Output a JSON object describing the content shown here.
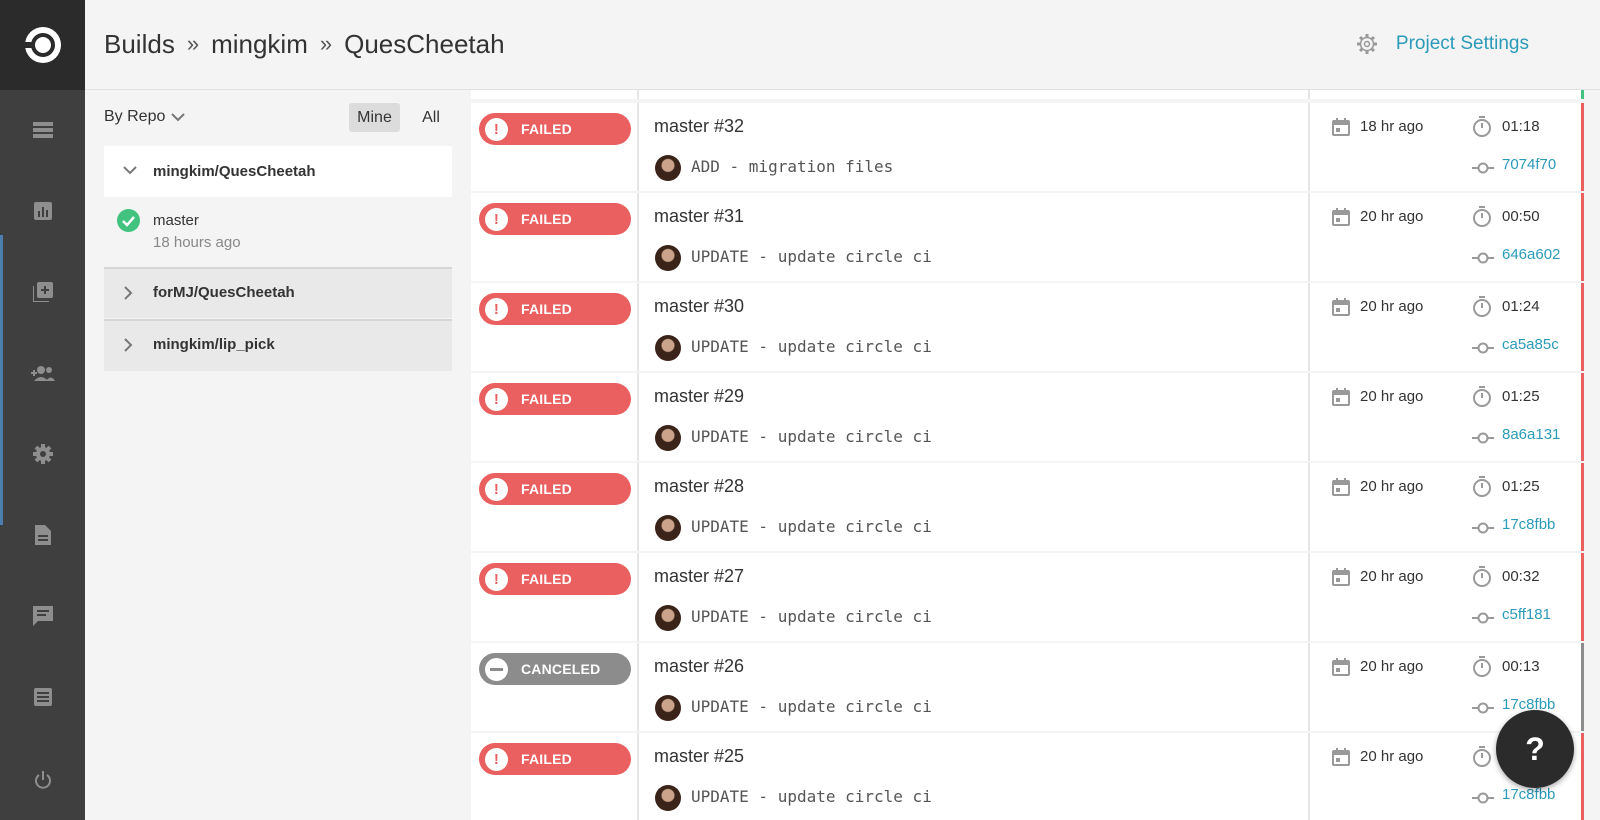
{
  "header": {
    "crumbs": [
      "Builds",
      "mingkim",
      "QuesCheetah"
    ],
    "separator": "»",
    "settings_label": "Project Settings"
  },
  "sidebar_rail": {
    "icons": [
      "circleci-logo-icon",
      "builds-icon",
      "insights-icon",
      "add-projects-icon",
      "team-icon",
      "settings-icon",
      "docs-icon",
      "support-icon",
      "changelog-icon",
      "logout-icon"
    ]
  },
  "repos": {
    "filter_label": "By Repo",
    "toggle_mine": "Mine",
    "toggle_all": "All",
    "items": [
      {
        "name": "mingkim/QuesCheetah",
        "expanded": true,
        "branches": [
          {
            "name": "master",
            "time": "18 hours ago",
            "status": "success"
          }
        ]
      },
      {
        "name": "forMJ/QuesCheetah",
        "expanded": false
      },
      {
        "name": "mingkim/lip_pick",
        "expanded": false
      }
    ]
  },
  "colors": {
    "failed": "#ea5f5f",
    "canceled": "#8c8c8c",
    "success": "#41c27e",
    "link": "#2a9bb8"
  },
  "builds": [
    {
      "status": "FAILED",
      "title": "master #32",
      "commit": "ADD - migration files",
      "ago": "18 hr ago",
      "duration": "01:18",
      "hash": "7074f70"
    },
    {
      "status": "FAILED",
      "title": "master #31",
      "commit": "UPDATE - update circle ci",
      "ago": "20 hr ago",
      "duration": "00:50",
      "hash": "646a602"
    },
    {
      "status": "FAILED",
      "title": "master #30",
      "commit": "UPDATE - update circle ci",
      "ago": "20 hr ago",
      "duration": "01:24",
      "hash": "ca5a85c"
    },
    {
      "status": "FAILED",
      "title": "master #29",
      "commit": "UPDATE - update circle ci",
      "ago": "20 hr ago",
      "duration": "01:25",
      "hash": "8a6a131"
    },
    {
      "status": "FAILED",
      "title": "master #28",
      "commit": "UPDATE - update circle ci",
      "ago": "20 hr ago",
      "duration": "01:25",
      "hash": "17c8fbb"
    },
    {
      "status": "FAILED",
      "title": "master #27",
      "commit": "UPDATE - update circle ci",
      "ago": "20 hr ago",
      "duration": "00:32",
      "hash": "c5ff181"
    },
    {
      "status": "CANCELED",
      "title": "master #26",
      "commit": "UPDATE - update circle ci",
      "ago": "20 hr ago",
      "duration": "00:13",
      "hash": "17c8fbb"
    },
    {
      "status": "FAILED",
      "title": "master #25",
      "commit": "UPDATE - update circle ci",
      "ago": "20 hr ago",
      "duration": "",
      "hash": "17c8fbb"
    }
  ],
  "help_label": "?"
}
